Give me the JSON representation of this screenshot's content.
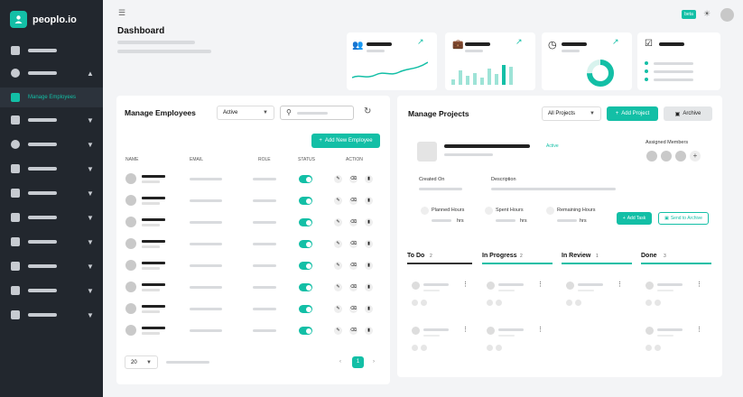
{
  "app": {
    "name": "peoplo.io",
    "badge": "beta"
  },
  "sidebar": {
    "active_label": "Manage Employees"
  },
  "header": {
    "title": "Dashboard"
  },
  "colors": {
    "accent": "#13bfa6",
    "sidebar_bg": "#22272e"
  },
  "employees": {
    "title": "Manage Employees",
    "filter_value": "Active",
    "add_button": "Add New Employee",
    "columns": [
      "NAME",
      "EMAIL",
      "ROLE",
      "STATUS",
      "ACTION"
    ],
    "page_size": "20",
    "current_page": "1"
  },
  "projects": {
    "title": "Manage Projects",
    "filter_value": "All Projects",
    "add_button": "Add Project",
    "archive_button": "Archive",
    "status_tag": "Active",
    "assigned_label": "Assigned Members",
    "created_label": "Created On",
    "description_label": "Description",
    "planned_label": "Planned Hours",
    "spent_label": "Spent Hours",
    "remaining_label": "Remaining Hours",
    "hrs_unit": "hrs",
    "add_task_button": "Add Task",
    "archive_project_button": "Send to Archive",
    "columns": [
      {
        "label": "To Do",
        "count": "2"
      },
      {
        "label": "In Progress",
        "count": "2"
      },
      {
        "label": "In Review",
        "count": "1"
      },
      {
        "label": "Done",
        "count": "3"
      }
    ]
  }
}
